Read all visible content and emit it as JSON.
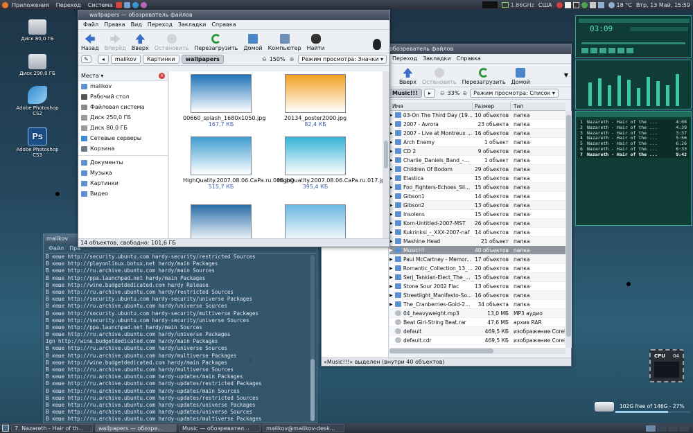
{
  "top_panel": {
    "apps": "Приложения",
    "places": "Переход",
    "system": "Система",
    "cpu_freq": "1.86GHz",
    "kb_layout": "США",
    "weather": "18 °C",
    "clock": "Втр, 13 Май, 15:59"
  },
  "desktop": {
    "icons": [
      {
        "label": "Диск 80,0 ГБ"
      },
      {
        "label": "Диск 290,0 ГБ"
      },
      {
        "label": "Adobe Photoshop CS2"
      },
      {
        "label": "Adobe Photoshop CS3"
      }
    ],
    "disk_free": "102G free of 146G - 27%",
    "cpu_widget": {
      "label": "CPU",
      "value": "04"
    }
  },
  "nautilus1": {
    "title": "wallpapers — обозреватель файлов",
    "menu": [
      "Файл",
      "Правка",
      "Вид",
      "Переход",
      "Закладки",
      "Справка"
    ],
    "toolbar": {
      "back": "Назад",
      "forward": "Вперёд",
      "up": "Вверх",
      "stop": "Остановить",
      "reload": "Перезагрузить",
      "home": "Домой",
      "computer": "Компьютер",
      "search": "Найти"
    },
    "crumbs": [
      "malikov",
      "Картинки",
      "wallpapers"
    ],
    "zoom": "150%",
    "view_mode": "Режим просмотра: Значки",
    "places_label": "Места",
    "places": [
      "malikov",
      "Рабочий стол",
      "Файловая система",
      "Диск 250,0 ГБ",
      "Диск 80,0 ГБ",
      "Сетевые серверы",
      "Корзина"
    ],
    "bookmarks": [
      "Документы",
      "Музыка",
      "Картинки",
      "Видео"
    ],
    "files": [
      {
        "name": "00660_splash_1680x1050.jpg",
        "size": "167,7 КБ",
        "color": "#1f73b8"
      },
      {
        "name": "20134_poster2000.jpg",
        "size": "82,4 КБ",
        "color": "#f0a020"
      },
      {
        "name": "HighQuality.2007.08.06.CaPa.ru.006.jpg",
        "size": "515,7 КБ",
        "color": "#3f9dd0"
      },
      {
        "name": "HighQuality.2007.08.06.CaPa.ru.017.jpg",
        "size": "395,4 КБ",
        "color": "#36b3d6"
      },
      {
        "name": "",
        "size": "",
        "color": "#2a6ea8"
      },
      {
        "name": "",
        "size": "",
        "color": "#6cb8e0"
      }
    ],
    "status": "14 объектов, свободно: 101,6 ГБ"
  },
  "nautilus2": {
    "title": "обозреватель файлов",
    "menu": [
      "Переход",
      "Закладки",
      "Справка"
    ],
    "toolbar": {
      "up": "Вверх",
      "stop": "Остановить",
      "reload": "Перезагрузить",
      "home": "Домой"
    },
    "crumb": "Music!!!",
    "zoom": "33%",
    "view_mode": "Режим просмотра: Список",
    "columns": {
      "name": "Имя",
      "size": "Размер",
      "type": "Тип"
    },
    "rows": [
      {
        "name": "03-On The Third Day (19...",
        "size": "10 объектов",
        "type": "папка",
        "kind": "folder"
      },
      {
        "name": "2007 - Avrora",
        "size": "23 объекта",
        "type": "папка",
        "kind": "folder"
      },
      {
        "name": "2007 - Live at Montreux ...",
        "size": "16 объектов",
        "type": "папка",
        "kind": "folder"
      },
      {
        "name": "Arch Enemy",
        "size": "1 объект",
        "type": "папка",
        "kind": "folder"
      },
      {
        "name": "CD 2",
        "size": "9 объектов",
        "type": "папка",
        "kind": "folder"
      },
      {
        "name": "Charlie_Daniels_Band_-...",
        "size": "1 объект",
        "type": "папка",
        "kind": "folder"
      },
      {
        "name": "Children Of Bodom",
        "size": "29 объектов",
        "type": "папка",
        "kind": "folder"
      },
      {
        "name": "Elastica",
        "size": "15 объектов",
        "type": "папка",
        "kind": "folder"
      },
      {
        "name": "Foo_Fighters-Echoes_Sil...",
        "size": "15 объектов",
        "type": "папка",
        "kind": "folder"
      },
      {
        "name": "Gibson1",
        "size": "14 объектов",
        "type": "папка",
        "kind": "folder"
      },
      {
        "name": "Gibson2",
        "size": "13 объектов",
        "type": "папка",
        "kind": "folder"
      },
      {
        "name": "Insolens",
        "size": "15 объектов",
        "type": "папка",
        "kind": "folder"
      },
      {
        "name": "Korn-Untitled-2007-MST",
        "size": "26 объектов",
        "type": "папка",
        "kind": "folder"
      },
      {
        "name": "Kukrinksi_-_XXX-2007-naf",
        "size": "14 объектов",
        "type": "папка",
        "kind": "folder"
      },
      {
        "name": "Mashine Head",
        "size": "21 объект",
        "type": "папка",
        "kind": "folder"
      },
      {
        "name": "Music!!!",
        "size": "40 объектов",
        "type": "папка",
        "kind": "folder",
        "selected": true
      },
      {
        "name": "Paul McCartney - Memor...",
        "size": "17 объектов",
        "type": "папка",
        "kind": "folder"
      },
      {
        "name": "Romantic_Collection_13_...",
        "size": "20 объектов",
        "type": "папка",
        "kind": "folder"
      },
      {
        "name": "Serj_Tankian-Elect_The_...",
        "size": "15 объектов",
        "type": "папка",
        "kind": "folder"
      },
      {
        "name": "Stone Sour 2002 Flac",
        "size": "13 объектов",
        "type": "папка",
        "kind": "folder"
      },
      {
        "name": "Streetlight_Manifesto-So...",
        "size": "16 объектов",
        "type": "папка",
        "kind": "folder"
      },
      {
        "name": "The_Cranberries-Gold-2...",
        "size": "34 объекта",
        "type": "папка",
        "kind": "folder"
      },
      {
        "name": "04_heavyweight.mp3",
        "size": "13,0 МБ",
        "type": "MP3 аудио",
        "kind": "file"
      },
      {
        "name": "Beat Girl-String Beat.rar",
        "size": "47,6 МБ",
        "type": "архив RAR",
        "kind": "file"
      },
      {
        "name": "default",
        "size": "469,5 КБ",
        "type": "изображение Corel",
        "kind": "file"
      },
      {
        "name": "default.cdr",
        "size": "469,5 КБ",
        "type": "изображение Corel",
        "kind": "file"
      }
    ],
    "status": "«Music!!!» выделен (внутри 40 объектов)"
  },
  "terminal": {
    "title": "malikov",
    "menu": [
      "Файл",
      "Пра"
    ],
    "lines": [
      "В кеше http://security.ubuntu.com hardy-security/restricted Sources",
      "В кеше http://playonlinux.botux.net hardy/main Packages",
      "В кеше http://ru.archive.ubuntu.com hardy/main Sources",
      "В кеше http://ppa.launchpad.net hardy/main Packages",
      "В кеше http://wine.budgetdedicated.com hardy Release",
      "В кеше http://ru.archive.ubuntu.com hardy/restricted Sources",
      "В кеше http://security.ubuntu.com hardy-security/universe Packages",
      "В кеше http://ru.archive.ubuntu.com hardy/universe Sources",
      "В кеше http://security.ubuntu.com hardy-security/multiverse Packages",
      "В кеше http://security.ubuntu.com hardy-security/universe Sources",
      "В кеше http://ppa.launchpad.net hardy/main Sources",
      "В кеше http://ru.archive.ubuntu.com hardy/universe Packages",
      "Ign http://wine.budgetdedicated.com hardy/main Packages",
      "В кеше http://ru.archive.ubuntu.com hardy/universe Sources",
      "В кеше http://ru.archive.ubuntu.com hardy/multiverse Packages",
      "В кеше http://wine.budgetdedicated.com hardy/main Packages",
      "В кеше http://ru.archive.ubuntu.com hardy/multiverse Sources",
      "В кеше http://ru.archive.ubuntu.com hardy-updates/main Packages",
      "В кеше http://ru.archive.ubuntu.com hardy-updates/restricted Packages",
      "В кеше http://ru.archive.ubuntu.com hardy-updates/main Sources",
      "В кеше http://ru.archive.ubuntu.com hardy-updates/restricted Sources",
      "В кеше http://ru.archive.ubuntu.com hardy-updates/universe Packages",
      "В кеше http://ru.archive.ubuntu.com hardy-updates/universe Sources",
      "В кеше http://ru.archive.ubuntu.com hardy-updates/multiverse Packages"
    ]
  },
  "winamp": {
    "time": "03:09",
    "playlist": [
      {
        "n": "1",
        "title": "Nazareth - Hair of the ...",
        "time": "4:08"
      },
      {
        "n": "2",
        "title": "Nazareth - Hair of the ...",
        "time": "4:39"
      },
      {
        "n": "3",
        "title": "Nazareth - Hair of the ...",
        "time": "3:37"
      },
      {
        "n": "4",
        "title": "Nazareth - Hair of the ...",
        "time": "5:56"
      },
      {
        "n": "5",
        "title": "Nazareth - Hair of the ...",
        "time": "6:26"
      },
      {
        "n": "6",
        "title": "Nazareth - Hair of the ...",
        "time": "6:33"
      },
      {
        "n": "7",
        "title": "Nazareth - Hair of the ...",
        "time": "9:42",
        "current": true
      }
    ]
  },
  "taskbar": [
    "7. Nazareth - Hair of th...",
    "wallpapers — обозре...",
    "Music — обозревател...",
    "malikov@malikov-desk..."
  ]
}
